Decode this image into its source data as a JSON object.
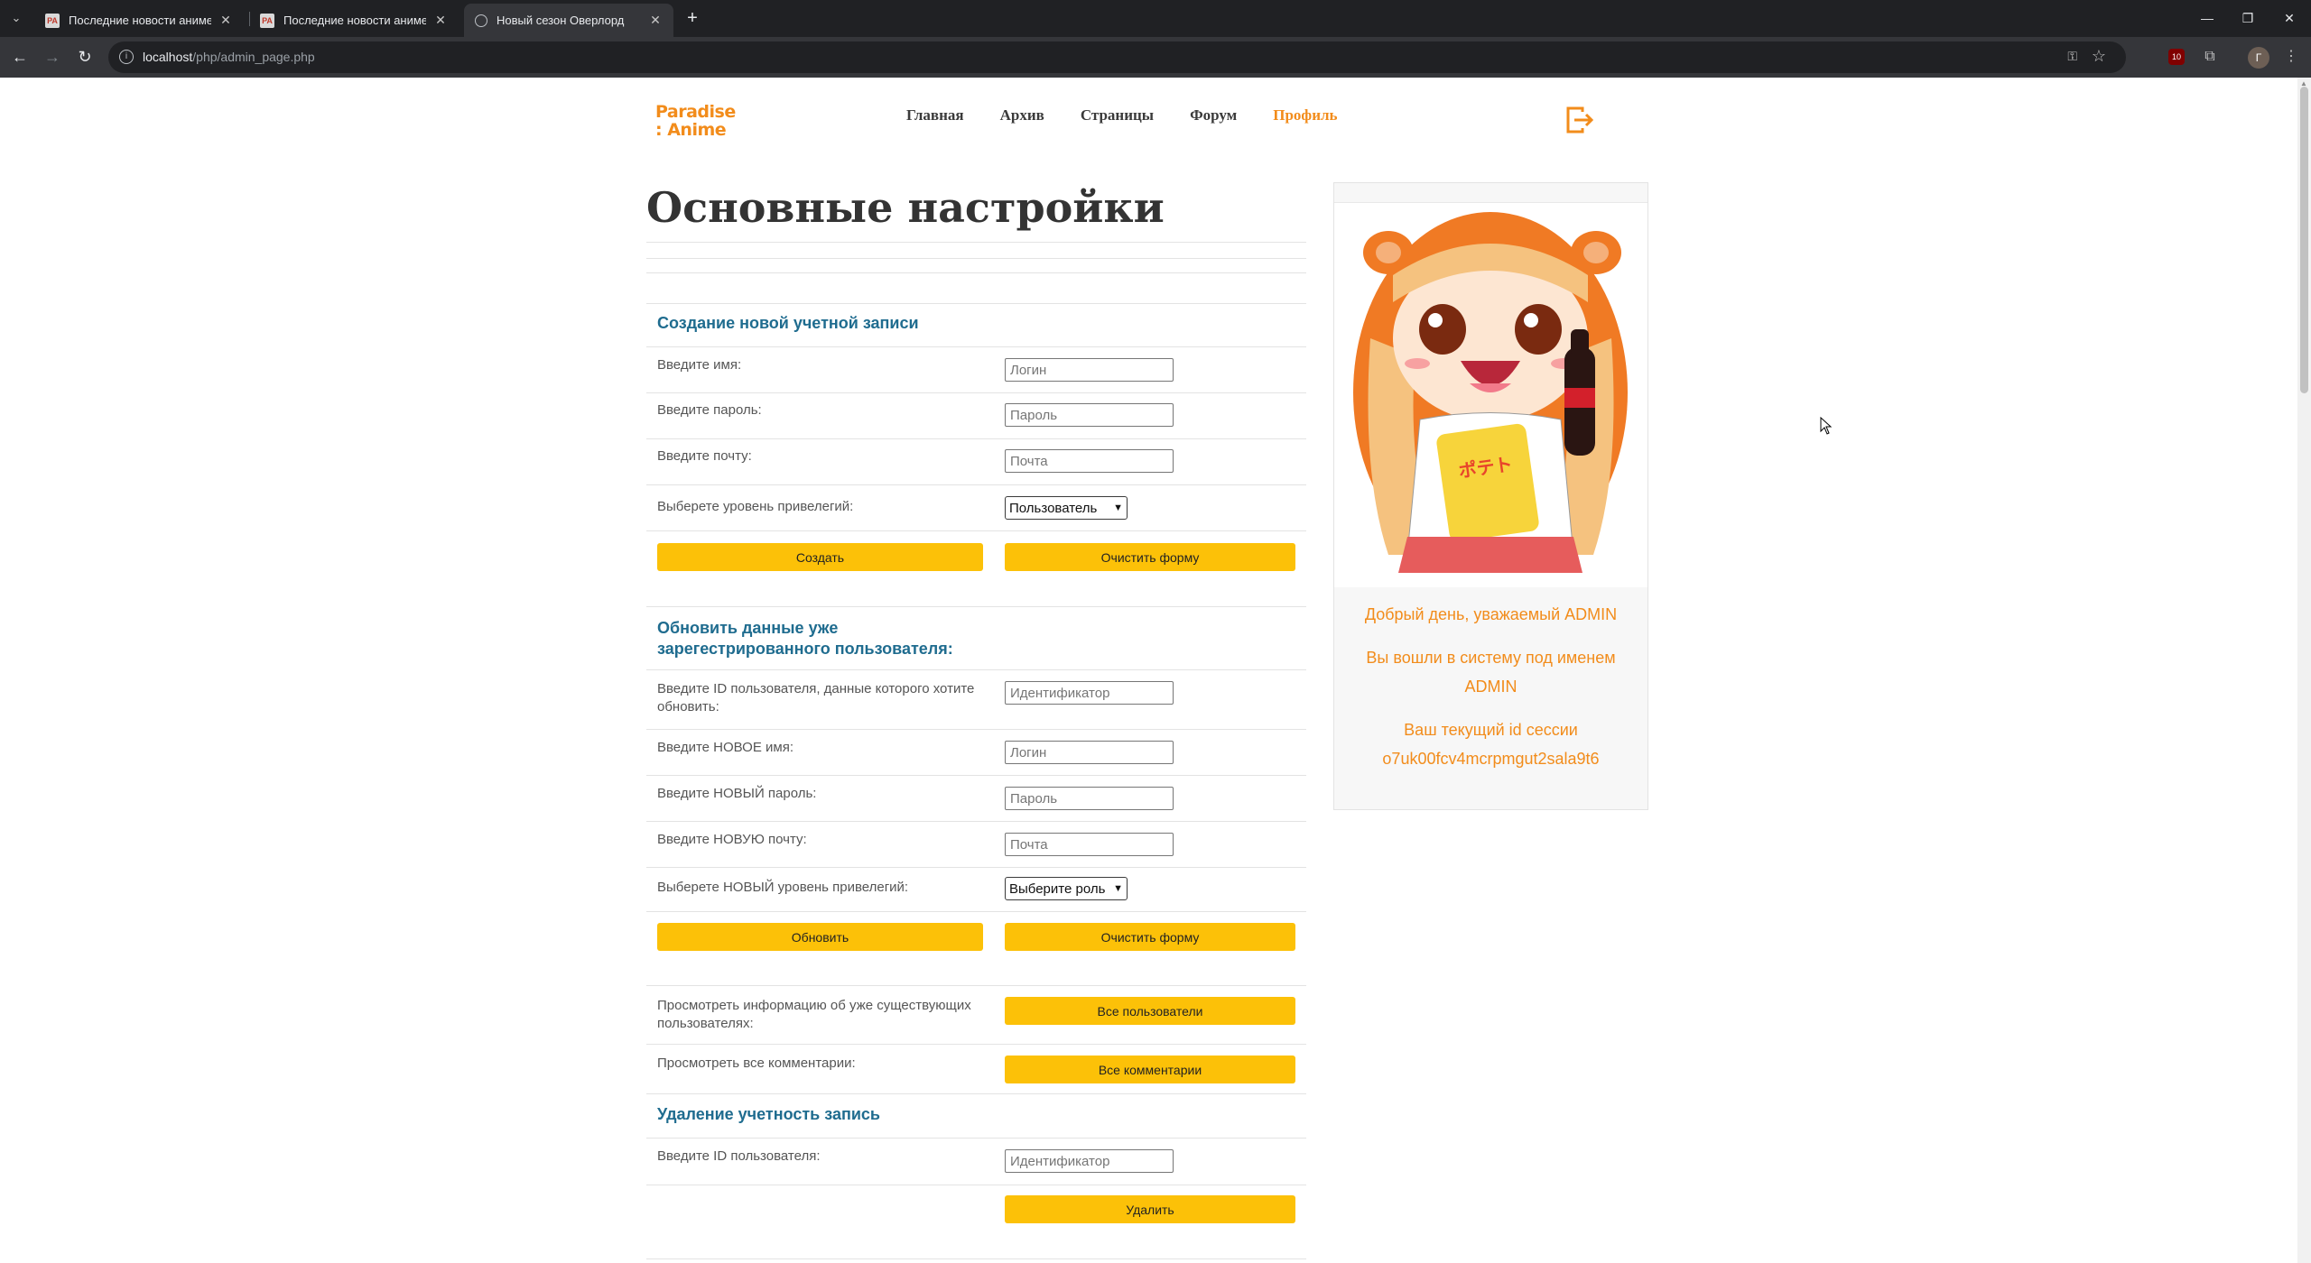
{
  "browser": {
    "tabs": [
      {
        "title": "Последние новости аниме и...",
        "active": false,
        "favicon": "pa-favicon"
      },
      {
        "title": "Последние новости аниме и...",
        "active": false,
        "favicon": "pa-favicon"
      },
      {
        "title": "Новый сезон Оверлорд",
        "active": true,
        "favicon": "globe-icon"
      }
    ],
    "url_host": "localhost",
    "url_path": "/php/admin_page.php",
    "profile_initial": "Г",
    "ublock_badge": "10"
  },
  "site": {
    "logo_line1": "Paradise",
    "logo_line2": ": Anime",
    "nav": [
      "Главная",
      "Архив",
      "Страницы",
      "Форум",
      "Профиль"
    ],
    "active_nav": "Профиль",
    "accent_color": "#f28c1b",
    "button_color": "#fcc108"
  },
  "main": {
    "title": "Основные настройки",
    "create": {
      "heading": "Создание новой учетной записи",
      "name_label": "Введите имя:",
      "name_placeholder": "Логин",
      "password_label": "Введите пароль:",
      "password_placeholder": "Пароль",
      "email_label": "Введите почту:",
      "email_placeholder": "Почта",
      "privilege_label": "Выберете уровень привелегий:",
      "privilege_value": "Пользователь",
      "submit": "Создать",
      "clear": "Очистить форму"
    },
    "update": {
      "heading": "Обновить данные уже зарегестрированного пользователя:",
      "id_label": "Введите ID пользователя, данные которого хотите обновить:",
      "id_placeholder": "Идентификатор",
      "name_label": "Введите НОВОЕ имя:",
      "name_placeholder": "Логин",
      "password_label": "Введите НОВЫЙ пароль:",
      "password_placeholder": "Пароль",
      "email_label": "Введите НОВУЮ почту:",
      "email_placeholder": "Почта",
      "privilege_label": "Выберете НОВЫЙ уровень привелегий:",
      "privilege_value": "Выберите роль",
      "submit": "Обновить",
      "clear": "Очистить форму"
    },
    "view": {
      "users_label": "Просмотреть информацию об уже существующих пользователях:",
      "users_button": "Все пользователи",
      "comments_label": "Просмотреть все комментарии:",
      "comments_button": "Все комментарии"
    },
    "delete": {
      "heading": "Удаление учетность запись",
      "id_label": "Введите ID пользователя:",
      "id_placeholder": "Идентификатор",
      "submit": "Удалить"
    }
  },
  "sidebar": {
    "greeting": "Добрый день, уважаемый ADMIN",
    "logged_in_line1": "Вы вошли в систему под именем",
    "logged_in_line2": "ADMIN",
    "session_line1": "Ваш текущий id сессии",
    "session_id": "o7uk00fcv4mcrpmgut2sala9t6"
  }
}
